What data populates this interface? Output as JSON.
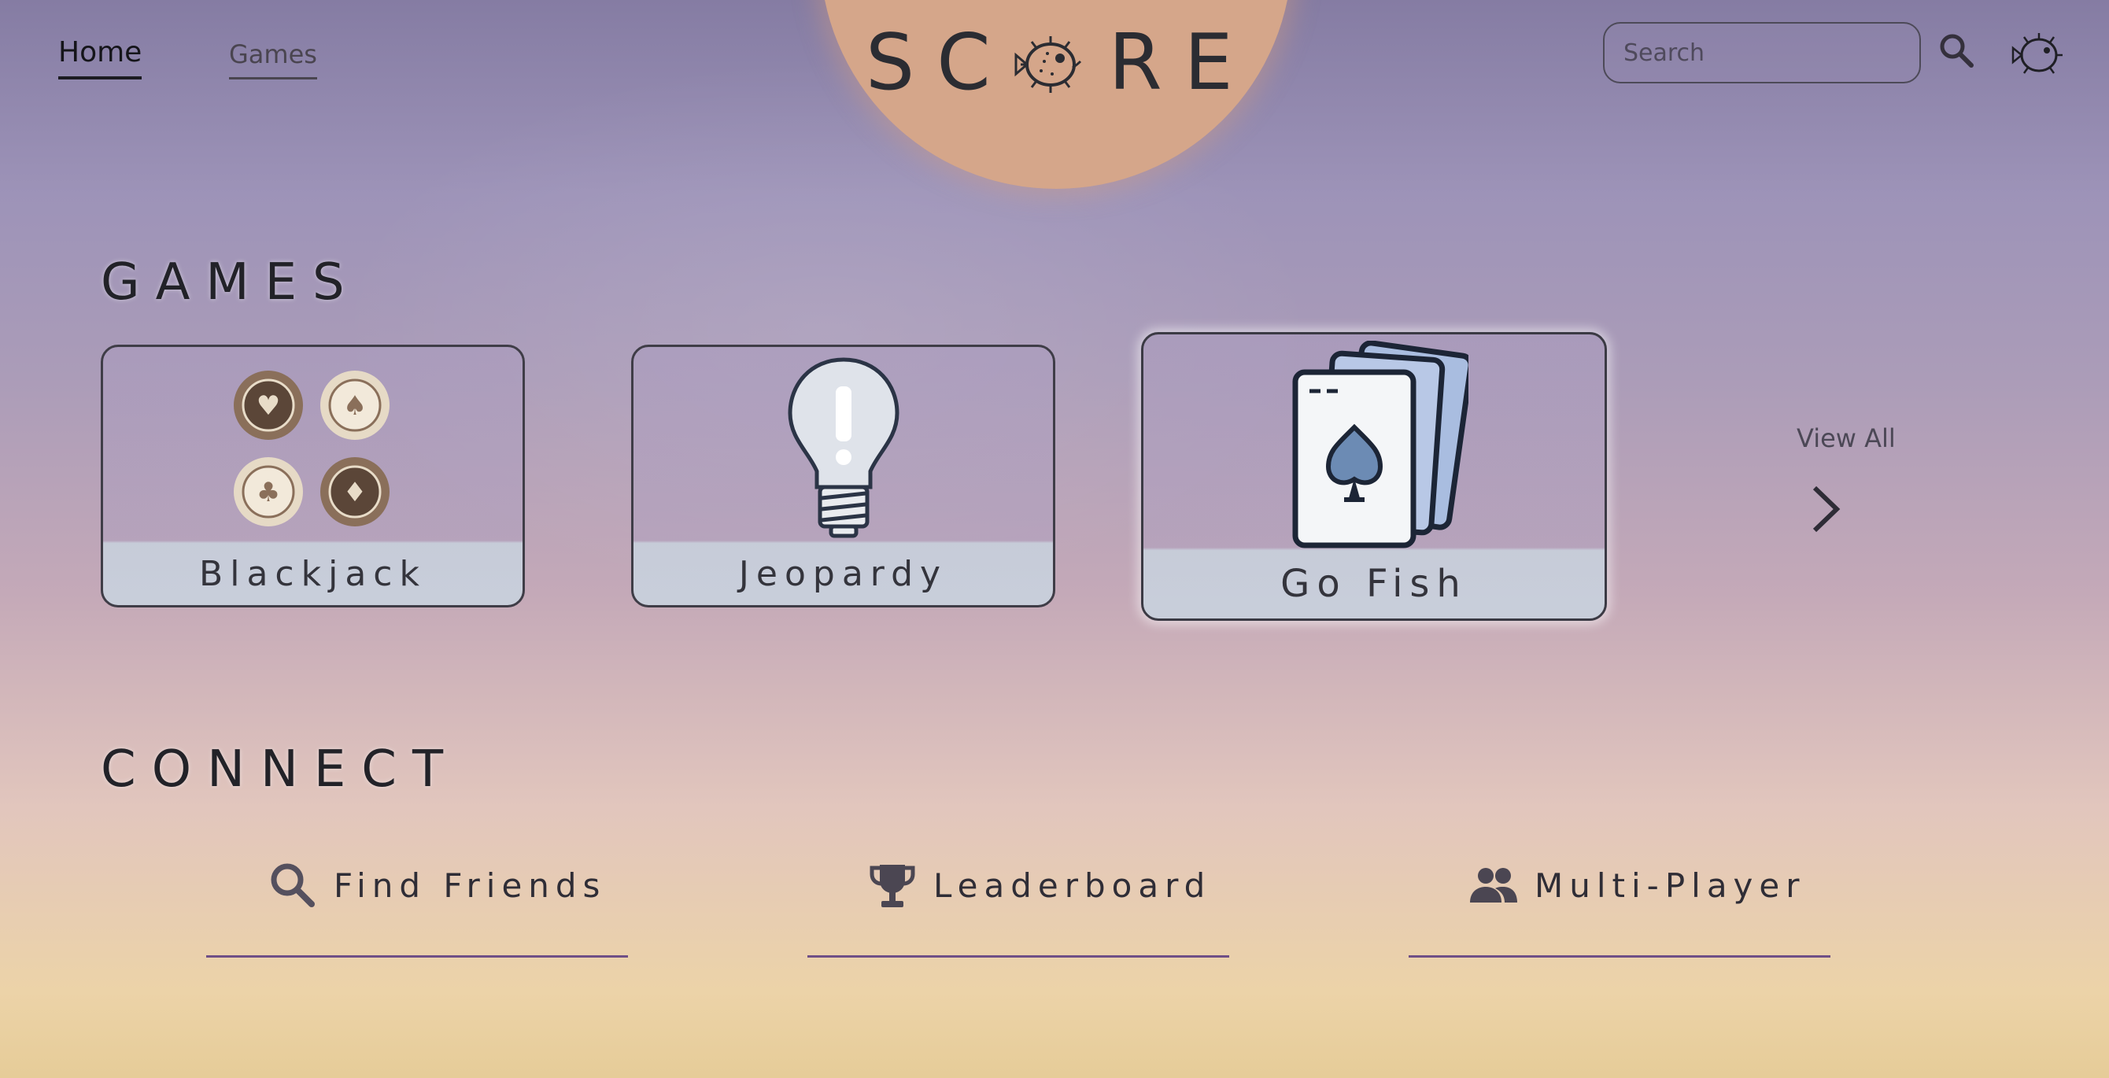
{
  "header": {
    "nav": [
      {
        "label": "Home",
        "active": true
      },
      {
        "label": "Games",
        "active": false
      }
    ],
    "logo_text": "SC  RE",
    "search": {
      "placeholder": "Search",
      "value": ""
    }
  },
  "games": {
    "title": "GAMES",
    "cards": [
      {
        "label": "Blackjack",
        "icon": "poker-chips-icon"
      },
      {
        "label": "Jeopardy",
        "icon": "lightbulb-icon"
      },
      {
        "label": "Go Fish",
        "icon": "playing-cards-icon"
      }
    ],
    "view_all": "View All"
  },
  "connect": {
    "title": "CONNECT",
    "items": [
      {
        "label": "Find Friends",
        "icon": "search-icon"
      },
      {
        "label": "Leaderboard",
        "icon": "trophy-icon"
      },
      {
        "label": "Multi-Player",
        "icon": "people-icon"
      }
    ]
  },
  "colors": {
    "sun": "#d5a68a",
    "underline": "#6f4f86",
    "card_border": "#3f3d47"
  }
}
